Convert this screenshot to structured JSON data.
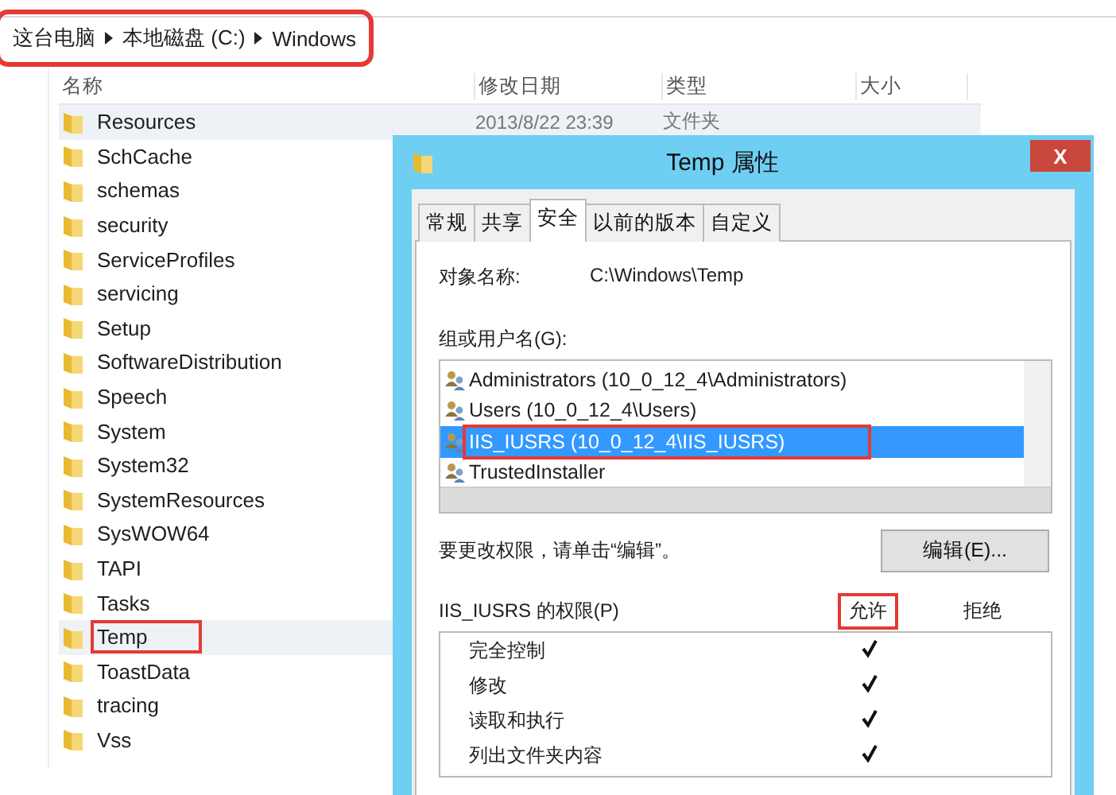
{
  "breadcrumb": {
    "items": [
      "这台电脑",
      "本地磁盘 (C:)",
      "Windows"
    ],
    "highlighted": true
  },
  "columns": [
    "名称",
    "修改日期",
    "类型",
    "大小"
  ],
  "files": [
    {
      "name": "Resources",
      "date": "2013/8/22 23:39",
      "type": "文件夹",
      "hovered": true,
      "highlighted": false
    },
    {
      "name": "SchCache",
      "hovered": false,
      "highlighted": false
    },
    {
      "name": "schemas",
      "hovered": false,
      "highlighted": false
    },
    {
      "name": "security",
      "hovered": false,
      "highlighted": false
    },
    {
      "name": "ServiceProfiles",
      "hovered": false,
      "highlighted": false
    },
    {
      "name": "servicing",
      "hovered": false,
      "highlighted": false
    },
    {
      "name": "Setup",
      "hovered": false,
      "highlighted": false
    },
    {
      "name": "SoftwareDistribution",
      "hovered": false,
      "highlighted": false
    },
    {
      "name": "Speech",
      "hovered": false,
      "highlighted": false
    },
    {
      "name": "System",
      "hovered": false,
      "highlighted": false
    },
    {
      "name": "System32",
      "hovered": false,
      "highlighted": false
    },
    {
      "name": "SystemResources",
      "hovered": false,
      "highlighted": false
    },
    {
      "name": "SysWOW64",
      "hovered": false,
      "highlighted": false
    },
    {
      "name": "TAPI",
      "hovered": false,
      "highlighted": false
    },
    {
      "name": "Tasks",
      "hovered": false,
      "highlighted": false
    },
    {
      "name": "Temp",
      "hovered": true,
      "highlighted": true
    },
    {
      "name": "ToastData",
      "hovered": false,
      "highlighted": false
    },
    {
      "name": "tracing",
      "hovered": false,
      "highlighted": false
    },
    {
      "name": "Vss",
      "hovered": false,
      "highlighted": false
    }
  ],
  "dialog": {
    "title": "Temp 属性",
    "close": "X",
    "tabs": [
      {
        "label": "常规",
        "selected": false
      },
      {
        "label": "共享",
        "selected": false
      },
      {
        "label": "安全",
        "selected": true
      },
      {
        "label": "以前的版本",
        "selected": false
      },
      {
        "label": "自定义",
        "selected": false
      }
    ],
    "object_label": "对象名称:",
    "object_value": "C:\\Windows\\Temp",
    "group_label": "组或用户名(G):",
    "users": [
      {
        "name": "Administrators (10_0_12_4\\Administrators)",
        "selected": false,
        "highlighted": false
      },
      {
        "name": "Users (10_0_12_4\\Users)",
        "selected": false,
        "highlighted": false
      },
      {
        "name": "IIS_IUSRS (10_0_12_4\\IIS_IUSRS)",
        "selected": true,
        "highlighted": true
      },
      {
        "name": "TrustedInstaller",
        "selected": false,
        "highlighted": false
      }
    ],
    "hint": "要更改权限，请单击“编辑”。",
    "edit_button": "编辑(E)...",
    "perm_label": "IIS_IUSRS 的权限(P)",
    "allow_header": "允许",
    "deny_header": "拒绝",
    "allow_highlighted": true,
    "permissions": [
      {
        "name": "完全控制",
        "allow": true
      },
      {
        "name": "修改",
        "allow": true
      },
      {
        "name": "读取和执行",
        "allow": true
      },
      {
        "name": "列出文件夹内容",
        "allow": true
      }
    ]
  }
}
